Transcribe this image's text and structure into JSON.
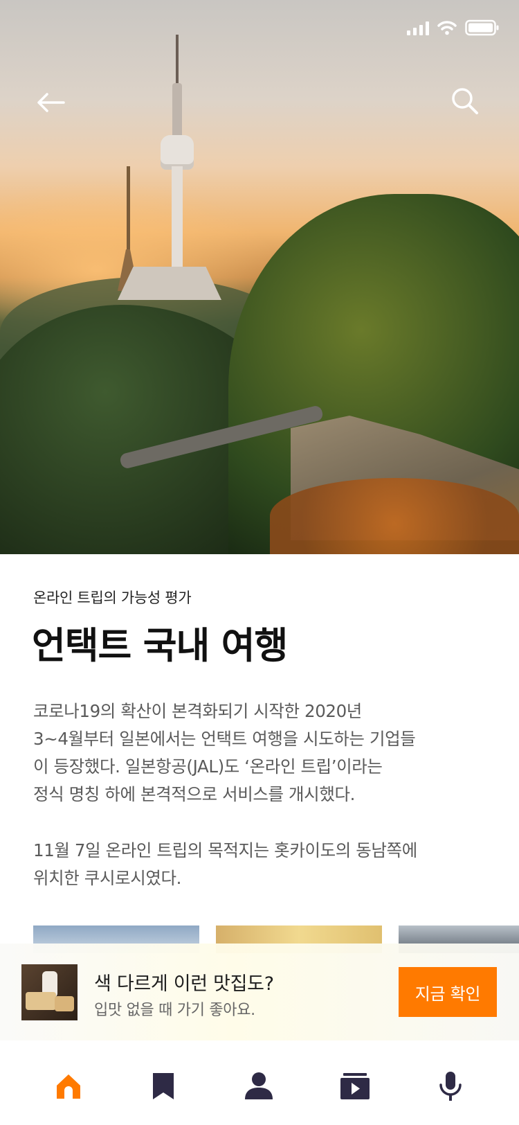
{
  "status_bar": {
    "signal": "signal-icon",
    "wifi": "wifi-icon",
    "battery": "battery-icon"
  },
  "header": {
    "back_icon": "arrow-left-icon",
    "search_icon": "search-icon"
  },
  "article": {
    "subtitle": "온라인 트립의 가능성 평가",
    "title": "언택트 국내 여행",
    "paragraph1_lines": [
      "코로나19의 확산이 본격화되기 시작한 2020년",
      "3~4월부터 일본에서는 언택트 여행을 시도하는 기업들",
      "이 등장했다. 일본항공(JAL)도 ‘온라인 트립’이라는",
      "정식 명칭 하에 본격적으로 서비스를 개시했다."
    ],
    "paragraph2_lines": [
      "11월 7일 온라인 트립의 목적지는 홋카이도의 동남쪽에",
      "위치한 쿠시로시였다."
    ]
  },
  "promo": {
    "title": "색 다르게 이런 맛집도?",
    "subtitle": "입맛 없을 때 가기 좋아요.",
    "button_label": "지금 확인",
    "accent": "#ff7a00"
  },
  "bottom_nav": {
    "items": [
      {
        "icon": "home-icon",
        "active": true
      },
      {
        "icon": "bookmark-icon",
        "active": false
      },
      {
        "icon": "user-icon",
        "active": false
      },
      {
        "icon": "video-icon",
        "active": false
      },
      {
        "icon": "microphone-icon",
        "active": false
      }
    ],
    "active_color": "#ff7a00",
    "inactive_color": "#2e2a45"
  }
}
